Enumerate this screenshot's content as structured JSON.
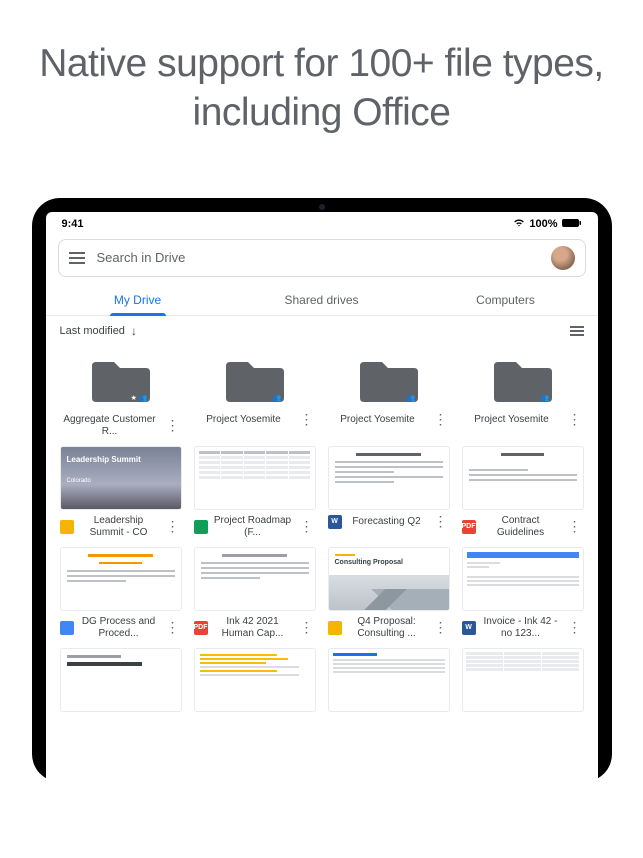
{
  "headline": "Native support for 100+ file types, including Office",
  "statusbar": {
    "time": "9:41",
    "battery": "100%"
  },
  "search": {
    "placeholder": "Search in Drive"
  },
  "tabs": [
    {
      "label": "My Drive",
      "active": true
    },
    {
      "label": "Shared drives",
      "active": false
    },
    {
      "label": "Computers",
      "active": false
    }
  ],
  "sort": {
    "label": "Last modified"
  },
  "folders": [
    {
      "name": "Aggregate Customer R..."
    },
    {
      "name": "Project Yosemite"
    },
    {
      "name": "Project Yosemite"
    },
    {
      "name": "Project Yosemite"
    }
  ],
  "files_row1": [
    {
      "name": "Leadership Summit - CO",
      "type": "slides",
      "thumb_title": "Leadership Summit",
      "thumb_sub": "Colorado"
    },
    {
      "name": "Project Roadmap (F...",
      "type": "sheets"
    },
    {
      "name": "Forecasting Q2",
      "type": "word"
    },
    {
      "name": "Contract Guidelines",
      "type": "pdf"
    }
  ],
  "files_row2": [
    {
      "name": "DG Process and Proced...",
      "type": "docs"
    },
    {
      "name": "Ink 42 2021 Human Cap...",
      "type": "pdf"
    },
    {
      "name": "Q4 Proposal: Consulting ...",
      "type": "slides",
      "thumb_title": "Consulting Proposal"
    },
    {
      "name": "Invoice - Ink 42 - no 123...",
      "type": "word"
    }
  ],
  "files_row3_thumbs": [
    "mp",
    "hc",
    "q4",
    "table"
  ]
}
